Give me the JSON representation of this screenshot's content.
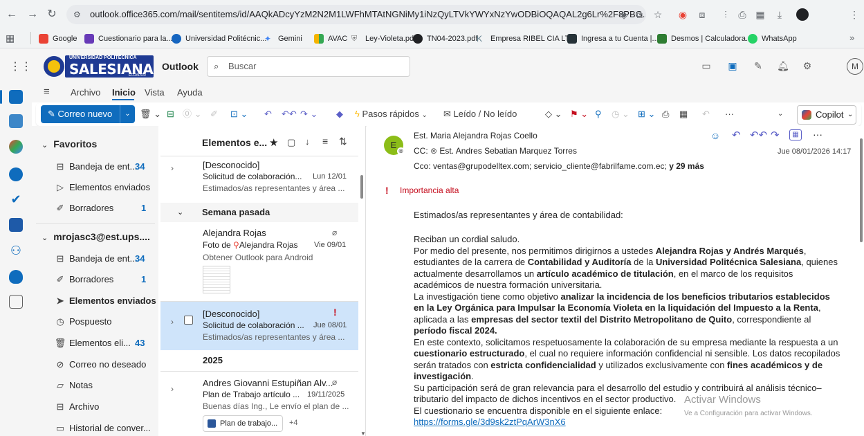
{
  "browser": {
    "url": "outlook.office365.com/mail/sentitems/id/AAQkADcyYzM2N2M1LWFhMTAtNGNiMy1iNzQyLTVkYWYxNzYwODBiOQAQAL2g6Lr%2F8PBG...",
    "bookmarks": [
      {
        "label": "Google",
        "color": "#ea4335"
      },
      {
        "label": "Cuestionario para la...",
        "color": "#673ab7"
      },
      {
        "label": "Universidad Politécnic...",
        "color": "#1565c0"
      },
      {
        "label": "Gemini",
        "color": "#4285f4"
      },
      {
        "label": "AVAC",
        "color": "#f4b400"
      },
      {
        "label": "Ley-Violeta.pdf",
        "color": "#757575"
      },
      {
        "label": "TN04-2023.pdf",
        "color": "#202124"
      },
      {
        "label": "Empresa RIBEL CIA LT...",
        "color": "#607d8b"
      },
      {
        "label": "Ingresa a tu Cuenta |...",
        "color": "#263238"
      },
      {
        "label": "Desmos | Calculadora...",
        "color": "#2e7d32"
      },
      {
        "label": "WhatsApp",
        "color": "#25d366"
      }
    ],
    "more_label": "»"
  },
  "header": {
    "logo_top": "UNIVERSIDAD POLITÉCNICA",
    "logo_main": "SALESIANA",
    "logo_bottom": "ECUADOR",
    "app_name": "Outlook",
    "search_placeholder": "Buscar",
    "avatar_initial": "M"
  },
  "ribbon": {
    "tabs": [
      "Archivo",
      "Inicio",
      "Vista",
      "Ayuda"
    ],
    "new_mail": "Correo nuevo",
    "quick_steps": "Pasos rápidos",
    "read_unread": "Leído / No leído",
    "more": "···",
    "copilot": "Copilot"
  },
  "folders": {
    "favorites_label": "Favoritos",
    "favorites": [
      {
        "label": "Bandeja de ent...",
        "count": "34"
      },
      {
        "label": "Elementos enviados",
        "count": ""
      },
      {
        "label": "Borradores",
        "count": "1"
      }
    ],
    "account_label": "mrojasc3@est.ups....",
    "account_items": [
      {
        "label": "Bandeja de ent...",
        "count": "34"
      },
      {
        "label": "Borradores",
        "count": "1"
      },
      {
        "label": "Elementos enviados",
        "count": ""
      },
      {
        "label": "Pospuesto",
        "count": ""
      },
      {
        "label": "Elementos eli...",
        "count": "43"
      },
      {
        "label": "Correo no deseado",
        "count": ""
      },
      {
        "label": "Notas",
        "count": ""
      },
      {
        "label": "Archivo",
        "count": ""
      },
      {
        "label": "Historial de conver...",
        "count": ""
      }
    ]
  },
  "list": {
    "title": "Elementos e...",
    "msg1": {
      "sender": "[Desconocido]",
      "subject": "Solicitud de colaboración...",
      "date": "Lun 12/01",
      "preview": "Estimados/as representantes y área ..."
    },
    "section_last_week": "Semana pasada",
    "msg2": {
      "sender": "Alejandra Rojas",
      "subject_prefix": "Foto de",
      "subject_name": "Alejandra Rojas",
      "date": "Vie 09/01",
      "preview": "Obtener Outlook para Android"
    },
    "msg3": {
      "sender": "[Desconocido]",
      "subject": "Solicitud de colaboración ...",
      "date": "Jue 08/01",
      "preview": "Estimados/as representantes y área ..."
    },
    "section_2025": "2025",
    "msg4": {
      "sender": "Andres Giovanni Estupiñan Alv...",
      "subject": "Plan de Trabajo artículo ...",
      "date": "19/11/2025",
      "preview": "Buenas días Ing., Le envío el plan de ...",
      "attachment": "Plan de trabajo...",
      "extra": "+4"
    }
  },
  "reading": {
    "avatar": "E",
    "from": "Est. Maria Alejandra Rojas Coello",
    "cc_label": "CC:",
    "cc": "Est. Andres Sebatian Marquez Torres",
    "date": "Jue 08/01/2026 14:17",
    "bcc": "Cco: ventas@grupodelltex.com;  servicio_cliente@fabrilfame.com.ec;",
    "bcc_more": "y 29 más",
    "importance": "Importancia alta",
    "greeting": "Estimados/as representantes y área de contabilidad:",
    "salutation": "Reciban un cordial saludo.",
    "p1_a": "Por medio del presente, nos permitimos dirigirnos a ustedes ",
    "p1_b": "Alejandra Rojas y Andrés Marqués",
    "p1_c": ", estudiantes de la carrera de ",
    "p1_d": "Contabilidad y Auditoría",
    "p1_e": " de la ",
    "p1_f": "Universidad Politécnica Salesiana",
    "p1_g": ", quienes actualmente desarrollamos un ",
    "p1_h": "artículo académico de titulación",
    "p1_i": ", en el marco de los requisitos académicos de nuestra formación universitaria.",
    "p2_a": "La investigación tiene como objetivo ",
    "p2_b": "analizar la incidencia de los beneficios tributarios establecidos en la Ley Orgánica para Impulsar la Economía Violeta en la liquidación del Impuesto a la Renta",
    "p2_c": ", aplicada a las ",
    "p2_d": "empresas del sector textil del Distrito Metropolitano de Quito",
    "p2_e": ", correspondiente al ",
    "p2_f": "período fiscal 2024.",
    "p3_a": "En este contexto, solicitamos respetuosamente la colaboración de su empresa mediante la respuesta a un ",
    "p3_b": "cuestionario estructurado",
    "p3_c": ", el cual no requiere información confidencial ni sensible. Los datos recopilados serán tratados con ",
    "p3_d": "estricta confidencialidad",
    "p3_e": " y utilizados exclusivamente con ",
    "p3_f": "fines académicos y de investigación",
    "p3_g": ".",
    "p4": "Su participación será de gran relevancia para el desarrollo del estudio y contribuirá al análisis técnico–tributario del impacto de dichos incentivos en el sector productivo.",
    "p5": "El cuestionario se encuentra disponible en el siguiente enlace:",
    "link": "https://forms.gle/3d9sk2ztPqArW3nX6"
  },
  "watermark": {
    "title": "Activar Windows",
    "subtitle": "Ve a Configuración para activar Windows."
  },
  "colors": {
    "accent": "#0f6cbd",
    "importance_red": "#c50f1f",
    "selected_row": "#cfe4fa",
    "avatar_green": "#8cbd18"
  }
}
